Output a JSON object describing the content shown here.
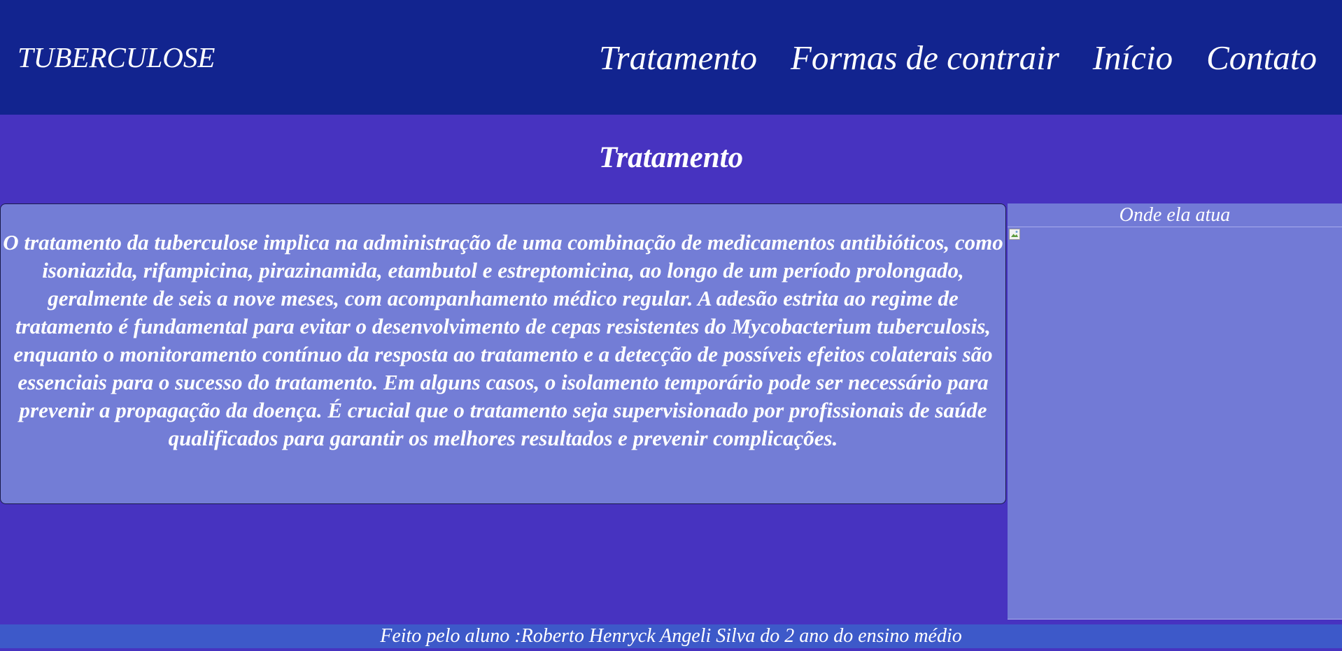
{
  "header": {
    "logo": "TUBERCULOSE",
    "nav": [
      {
        "label": "Tratamento"
      },
      {
        "label": "Formas de contrair"
      },
      {
        "label": "Início"
      },
      {
        "label": "Contato"
      }
    ]
  },
  "main": {
    "title": "Tratamento",
    "body": "O tratamento da tuberculose implica na administração de uma combinação de medicamentos antibióticos, como isoniazida, rifampicina, pirazinamida, etambutol e estreptomicina, ao longo de um período prolongado, geralmente de seis a nove meses, com acompanhamento médico regular. A adesão estrita ao regime de tratamento é fundamental para evitar o desenvolvimento de cepas resistentes do Mycobacterium tuberculosis, enquanto o monitoramento contínuo da resposta ao tratamento e a detecção de possíveis efeitos colaterais são essenciais para o sucesso do tratamento. Em alguns casos, o isolamento temporário pode ser necessário para prevenir a propagação da doença. É crucial que o tratamento seja supervisionado por profissionais de saúde qualificados para garantir os melhores resultados e prevenir complicações."
  },
  "aside": {
    "caption": "Onde ela atua",
    "image_icon": "broken-image-icon"
  },
  "footer": {
    "text": "Feito pelo aluno :Roberto Henryck Angeli Silva do 2 ano do ensino médio"
  },
  "colors": {
    "header_bg": "#12248f",
    "page_bg": "#4733c0",
    "text_box_bg": "#737dd6",
    "aside_bg": "#727ad6",
    "footer_bg": "#3d59c9",
    "text": "#ffffff"
  }
}
